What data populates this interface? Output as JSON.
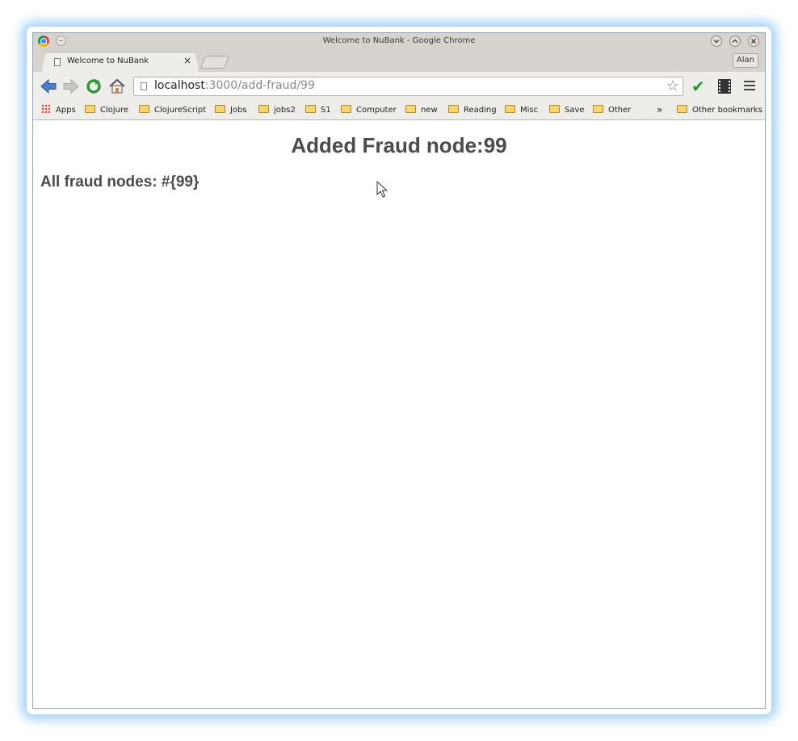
{
  "window": {
    "title": "Welcome to NuBank - Google Chrome"
  },
  "tab": {
    "title": "Welcome to NuBank",
    "close": "×"
  },
  "profile": {
    "name": "Alan"
  },
  "address_bar": {
    "host": "localhost",
    "rest": ":3000/add-fraud/99"
  },
  "bookmarks": [
    {
      "label": "Apps",
      "type": "apps"
    },
    {
      "label": "Clojure",
      "type": "folder"
    },
    {
      "label": "ClojureScript",
      "type": "folder"
    },
    {
      "label": "Jobs",
      "type": "folder"
    },
    {
      "label": "jobs2",
      "type": "folder"
    },
    {
      "label": "S1",
      "type": "folder"
    },
    {
      "label": "Computer",
      "type": "folder"
    },
    {
      "label": "new",
      "type": "folder"
    },
    {
      "label": "Reading",
      "type": "folder"
    },
    {
      "label": "Misc",
      "type": "folder"
    },
    {
      "label": "Save",
      "type": "folder"
    },
    {
      "label": "Other",
      "type": "folder"
    }
  ],
  "bookmarks_overflow": "»",
  "other_bookmarks": "Other bookmarks",
  "page": {
    "heading": "Added Fraud node:99",
    "subheading": "All fraud nodes: #{99}"
  },
  "colors": {
    "check": "#1c9c2f",
    "text": "#4b4b4b"
  }
}
